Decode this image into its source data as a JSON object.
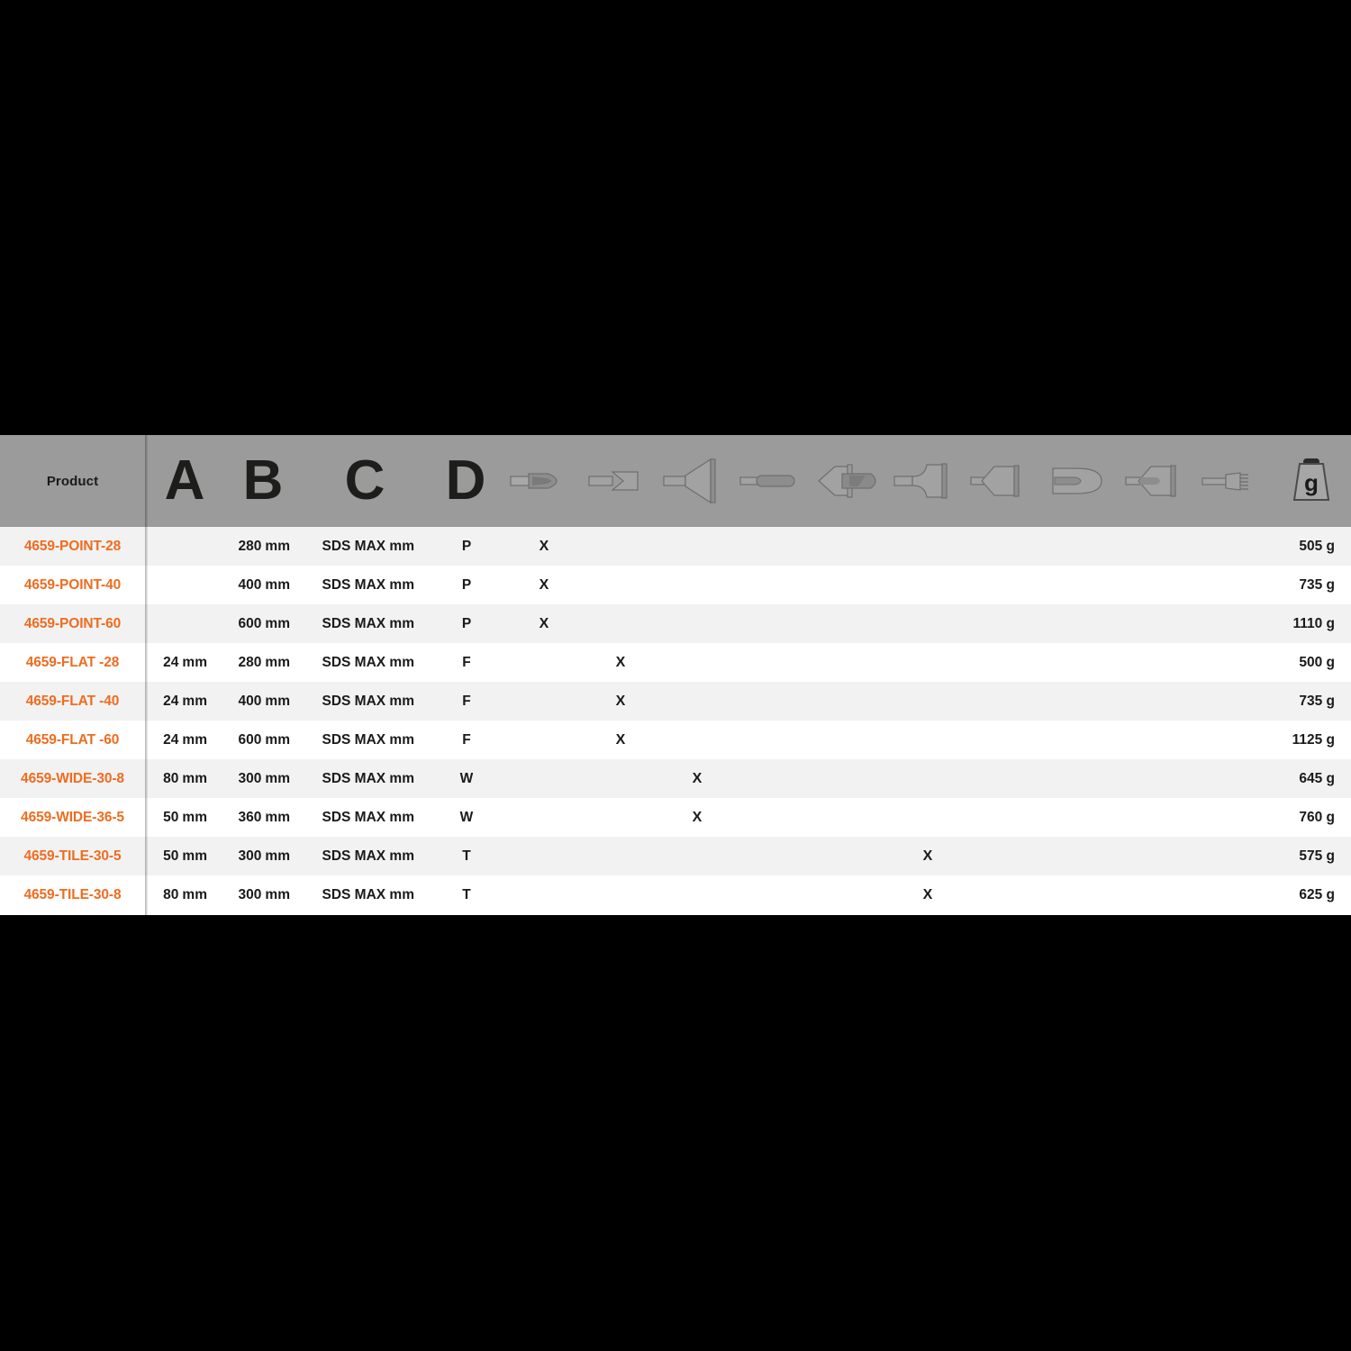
{
  "table": {
    "header": {
      "product_label": "Product",
      "letters": [
        "A",
        "B",
        "C",
        "D"
      ],
      "icon_columns": [
        {
          "name": "point-chisel-icon",
          "code": "P"
        },
        {
          "name": "flat-chisel-icon",
          "code": "F"
        },
        {
          "name": "wide-chisel-icon",
          "code": "W"
        },
        {
          "name": "narrow-flat-chisel-icon",
          "code": "NF"
        },
        {
          "name": "bushing-point-chisel-icon",
          "code": "BP"
        },
        {
          "name": "wide-flat-chisel-icon",
          "code": "WF"
        },
        {
          "name": "tile-chisel-icon",
          "code": "T"
        },
        {
          "name": "spade-chisel-icon",
          "code": "S"
        },
        {
          "name": "clay-spade-icon",
          "code": "CS"
        },
        {
          "name": "comb-chisel-icon",
          "code": "CC"
        }
      ],
      "weight_icon": {
        "name": "weight-icon",
        "label": "g"
      }
    },
    "rows": [
      {
        "product": "4659-POINT-28",
        "a": "",
        "a_unit": "",
        "b": "280",
        "b_unit": "mm",
        "c": "SDS MAX mm",
        "d": "P",
        "mark_col": 0,
        "weight": "505 g"
      },
      {
        "product": "4659-POINT-40",
        "a": "",
        "a_unit": "",
        "b": "400",
        "b_unit": "mm",
        "c": "SDS MAX mm",
        "d": "P",
        "mark_col": 0,
        "weight": "735 g"
      },
      {
        "product": "4659-POINT-60",
        "a": "",
        "a_unit": "",
        "b": "600",
        "b_unit": "mm",
        "c": "SDS MAX mm",
        "d": "P",
        "mark_col": 0,
        "weight": "1110 g"
      },
      {
        "product": "4659-FLAT -28",
        "a": "24",
        "a_unit": "mm",
        "b": "280",
        "b_unit": "mm",
        "c": "SDS MAX mm",
        "d": "F",
        "mark_col": 1,
        "weight": "500 g"
      },
      {
        "product": "4659-FLAT -40",
        "a": "24",
        "a_unit": "mm",
        "b": "400",
        "b_unit": "mm",
        "c": "SDS MAX mm",
        "d": "F",
        "mark_col": 1,
        "weight": "735 g"
      },
      {
        "product": "4659-FLAT -60",
        "a": "24",
        "a_unit": "mm",
        "b": "600",
        "b_unit": "mm",
        "c": "SDS MAX mm",
        "d": "F",
        "mark_col": 1,
        "weight": "1125 g"
      },
      {
        "product": "4659-WIDE-30-8",
        "a": "80",
        "a_unit": "mm",
        "b": "300",
        "b_unit": "mm",
        "c": "SDS MAX mm",
        "d": "W",
        "mark_col": 2,
        "weight": "645 g"
      },
      {
        "product": "4659-WIDE-36-5",
        "a": "50",
        "a_unit": "mm",
        "b": "360",
        "b_unit": "mm",
        "c": "SDS MAX mm",
        "d": "W",
        "mark_col": 2,
        "weight": "760 g"
      },
      {
        "product": "4659-TILE-30-5",
        "a": "50",
        "a_unit": "mm",
        "b": "300",
        "b_unit": "mm",
        "c": "SDS MAX mm",
        "d": "T",
        "mark_col": 5,
        "weight": "575 g"
      },
      {
        "product": "4659-TILE-30-8",
        "a": "80",
        "a_unit": "mm",
        "b": "300",
        "b_unit": "mm",
        "c": "SDS MAX mm",
        "d": "T",
        "mark_col": 5,
        "weight": "625 g"
      }
    ],
    "mark_symbol": "X"
  },
  "colors": {
    "header_bg": "#9b9b9b",
    "row_odd_bg": "#f2f2f2",
    "row_even_bg": "#ffffff",
    "product_text": "#ef6c1f",
    "body_text": "#1a1a1a",
    "page_bg": "#000000"
  },
  "layout": {
    "col_x": {
      "product_w": 161,
      "a": 230,
      "b": 322,
      "c": 460,
      "d": 518,
      "icons": [
        604,
        689,
        774,
        859,
        945,
        1030,
        1115,
        1200,
        1287,
        1372
      ],
      "weight_right": 18
    }
  }
}
